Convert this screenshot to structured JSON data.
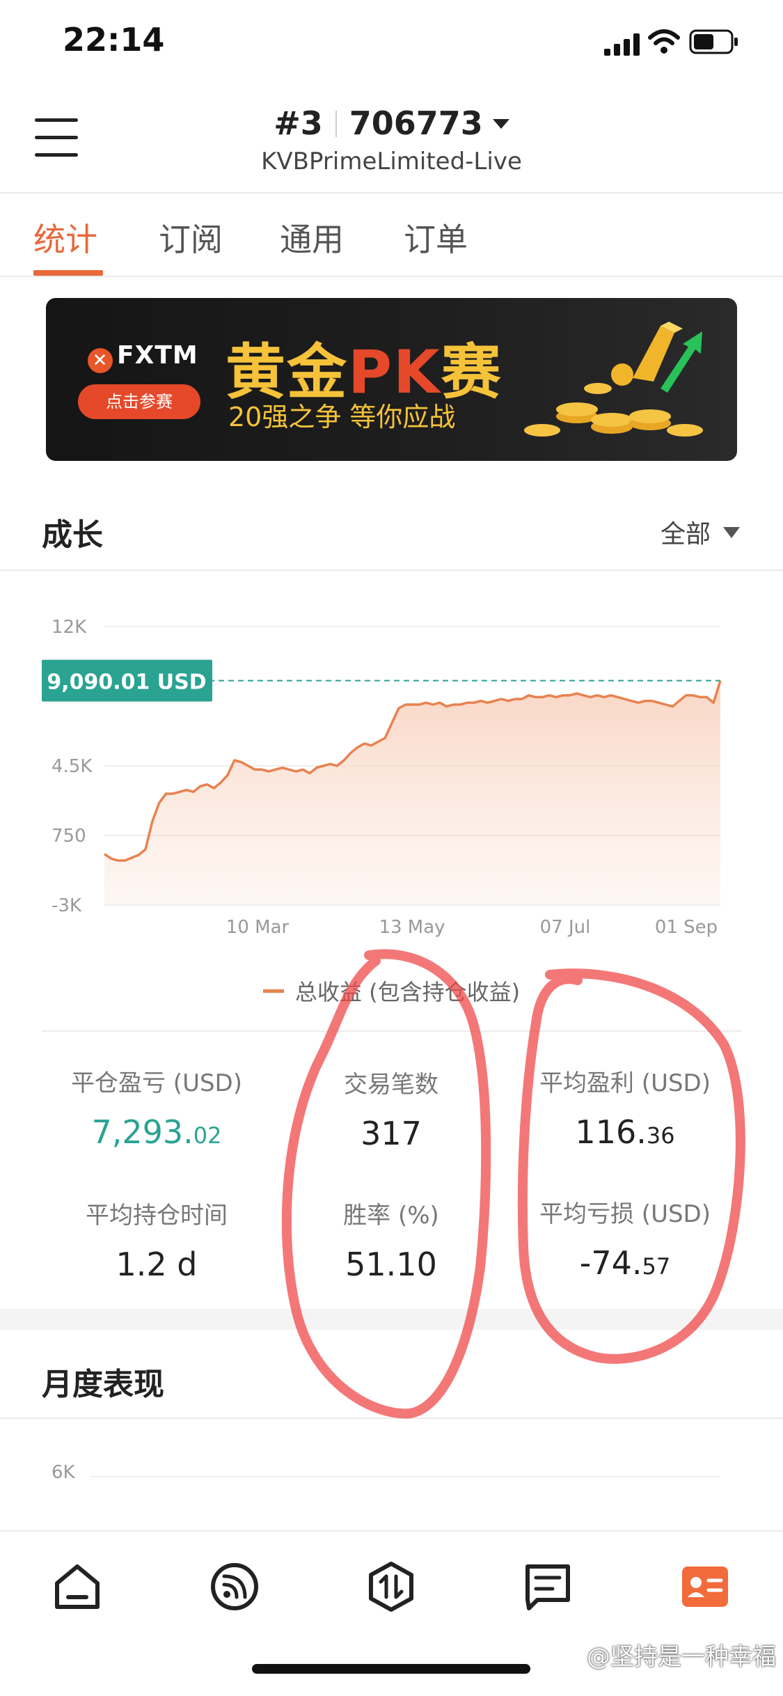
{
  "status_bar": {
    "time": "22:14"
  },
  "header": {
    "account_rank": "#3",
    "account_number": "706773",
    "broker_name": "KVBPrimeLimited-Live"
  },
  "tabs": [
    {
      "label": "统计",
      "active": true
    },
    {
      "label": "订阅",
      "active": false
    },
    {
      "label": "通用",
      "active": false
    },
    {
      "label": "订单",
      "active": false
    }
  ],
  "banner": {
    "brand": "FXTM",
    "button_label": "点击参赛",
    "title_main_1": "黄金",
    "title_pk": "PK",
    "title_main_2": "赛",
    "subtitle": "20强之争  等你应战"
  },
  "growth_section": {
    "title": "成长",
    "filter_label": "全部"
  },
  "chart_data": {
    "type": "area",
    "y_ticks": [
      "12K",
      "4.5K",
      "750",
      "-3K"
    ],
    "x_ticks": [
      "10 Mar",
      "13 May",
      "07 Jul",
      "01 Sep"
    ],
    "current_value_label": "9,090.01 USD",
    "current_value": 9090.01,
    "ylim": [
      -3000,
      12000
    ],
    "legend": "总收益 (包含持仓收益)",
    "series": [
      {
        "name": "总收益 (包含持仓收益)",
        "values": [
          -250,
          -500,
          -600,
          -600,
          -450,
          -300,
          0,
          1500,
          2500,
          3000,
          3000,
          3100,
          3200,
          3100,
          3400,
          3500,
          3300,
          3600,
          4000,
          4800,
          4700,
          4500,
          4300,
          4300,
          4200,
          4300,
          4400,
          4300,
          4200,
          4300,
          4100,
          4400,
          4500,
          4600,
          4500,
          4800,
          5200,
          5500,
          5700,
          5600,
          5800,
          6000,
          6800,
          7600,
          7800,
          7800,
          7800,
          7900,
          7800,
          7900,
          7700,
          7800,
          7800,
          7900,
          7900,
          8000,
          7900,
          8000,
          8100,
          8000,
          8100,
          8100,
          8300,
          8200,
          8200,
          8300,
          8200,
          8300,
          8300,
          8400,
          8300,
          8200,
          8300,
          8200,
          8300,
          8200,
          8100,
          8000,
          7900,
          8000,
          8000,
          7900,
          7800,
          7700,
          8000,
          8300,
          8300,
          8200,
          8200,
          7900,
          9090
        ]
      }
    ]
  },
  "stats": {
    "closed_pnl_label": "平仓盈亏 (USD)",
    "closed_pnl_int": "7,293.",
    "closed_pnl_dec": "02",
    "trades_label": "交易笔数",
    "trades_value": "317",
    "avg_profit_label": "平均盈利 (USD)",
    "avg_profit_int": "116.",
    "avg_profit_dec": "36",
    "avg_hold_label": "平均持仓时间",
    "avg_hold_value": "1.2 d",
    "win_rate_label": "胜率 (%)",
    "win_rate_value": "51.10",
    "avg_loss_label": "平均亏损 (USD)",
    "avg_loss_int": "-74.",
    "avg_loss_dec": "57"
  },
  "monthly_section": {
    "title": "月度表现",
    "first_tick": "6K"
  },
  "bottom_nav": {
    "items": [
      {
        "icon": "home-icon"
      },
      {
        "icon": "feed-icon"
      },
      {
        "icon": "trade-icon"
      },
      {
        "icon": "message-icon"
      },
      {
        "icon": "account-icon",
        "active": true
      }
    ]
  },
  "watermark": "@坚持是一种幸福",
  "colors": {
    "accent": "#e8683a",
    "positive": "#2aa392",
    "line": "#e8824f",
    "annotation": "#f04a4a"
  }
}
